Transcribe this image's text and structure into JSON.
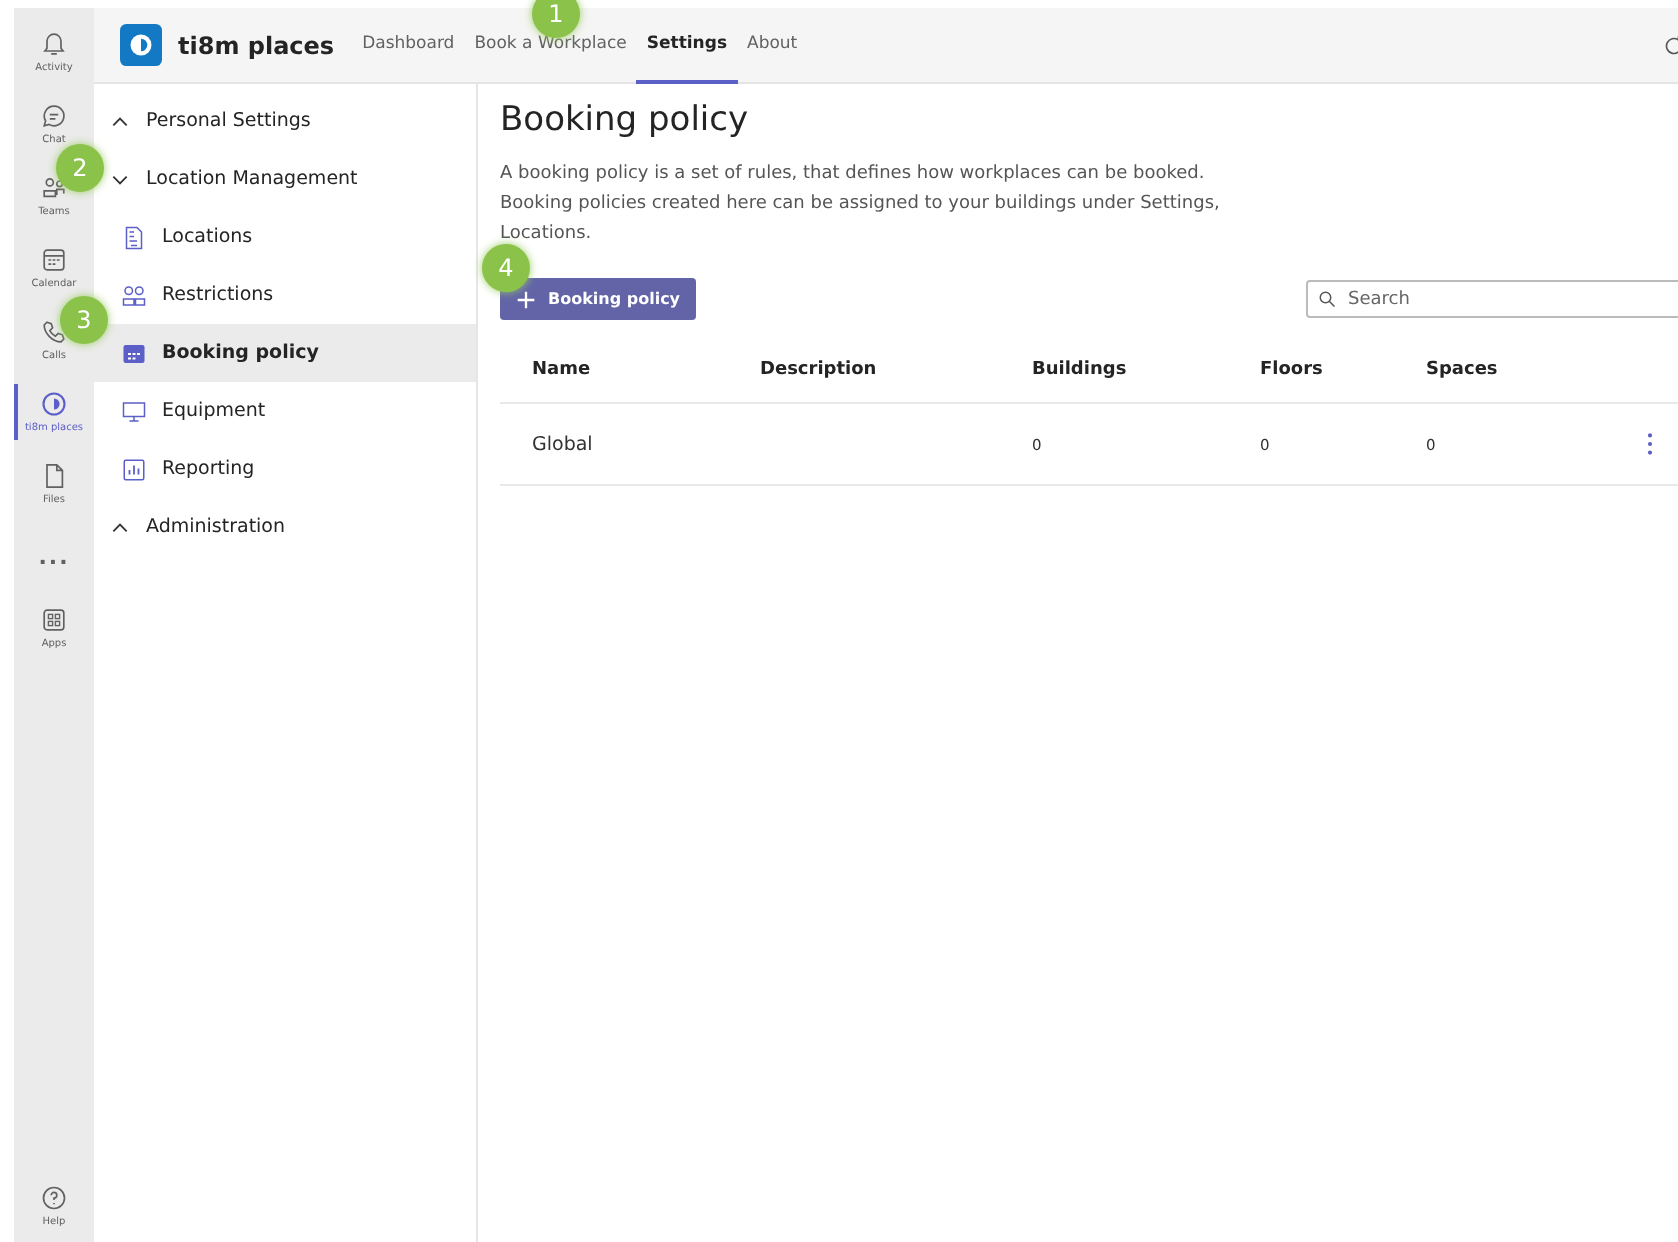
{
  "rail": [
    {
      "kind": "bell",
      "label": "Activity",
      "selected": false
    },
    {
      "kind": "chat",
      "label": "Chat",
      "selected": false
    },
    {
      "kind": "teams",
      "label": "Teams",
      "selected": false
    },
    {
      "kind": "calendar",
      "label": "Calendar",
      "selected": false
    },
    {
      "kind": "phone",
      "label": "Calls",
      "selected": false
    },
    {
      "kind": "places",
      "label": "ti8m places",
      "selected": true
    },
    {
      "kind": "file",
      "label": "Files",
      "selected": false
    },
    {
      "kind": "more",
      "label": "...",
      "selected": false
    },
    {
      "kind": "apps",
      "label": "Apps",
      "selected": false
    }
  ],
  "help": {
    "label": "Help"
  },
  "app": {
    "name": "ti8m places"
  },
  "tabs": [
    {
      "label": "Dashboard",
      "selected": false
    },
    {
      "label": "Book a Workplace",
      "selected": false
    },
    {
      "label": "Settings",
      "selected": true
    },
    {
      "label": "About",
      "selected": false
    }
  ],
  "sidebar": [
    {
      "kind": "group",
      "label": "Personal Settings",
      "expanded": false
    },
    {
      "kind": "group",
      "label": "Location Management",
      "expanded": true
    },
    {
      "kind": "item",
      "label": "Locations",
      "selected": false
    },
    {
      "kind": "item",
      "label": "Restrictions",
      "selected": false
    },
    {
      "kind": "item",
      "label": "Booking policy",
      "selected": true
    },
    {
      "kind": "item",
      "label": "Equipment",
      "selected": false
    },
    {
      "kind": "item",
      "label": "Reporting",
      "selected": false
    },
    {
      "kind": "group",
      "label": "Administration",
      "expanded": false
    }
  ],
  "page": {
    "title": "Booking policy",
    "description": "A booking policy is a set of rules, that defines how workplaces can be booked. Booking policies created here can be assigned to your buildings under Settings, Locations.",
    "add_button": "Booking policy",
    "search": {
      "placeholder": "Search"
    }
  },
  "table": {
    "columns": [
      "Name",
      "Description",
      "Buildings",
      "Floors",
      "Spaces"
    ],
    "rows": [
      {
        "cells": [
          "Global",
          "",
          "0",
          "0",
          "0"
        ]
      }
    ]
  },
  "callouts": [
    "1",
    "2",
    "3",
    "4"
  ]
}
